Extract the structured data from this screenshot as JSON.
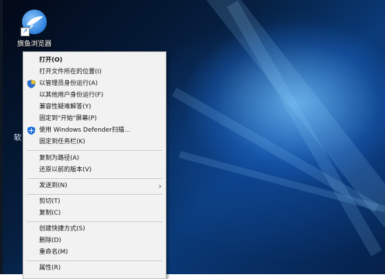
{
  "desktop": {
    "shortcut_label": "旗鱼浏览器",
    "side_text": "软"
  },
  "context_menu": {
    "open": "打开(O)",
    "open_location": "打开文件所在的位置(I)",
    "run_as_admin": "以管理员身份运行(A)",
    "run_as_other_user": "以其他用户身份运行(F)",
    "troubleshoot_compat": "兼容性疑难解答(Y)",
    "pin_to_start": "固定到\"开始\"屏幕(P)",
    "defender_scan": "使用 Windows Defender扫描...",
    "pin_to_taskbar": "固定到任务栏(K)",
    "copy_as_path": "复制为路径(A)",
    "restore_previous": "还原以前的版本(V)",
    "send_to": "发送到(N)",
    "cut": "剪切(T)",
    "copy": "复制(C)",
    "create_shortcut": "创建快捷方式(S)",
    "delete": "删除(D)",
    "rename": "重命名(M)",
    "properties": "属性(R)"
  }
}
